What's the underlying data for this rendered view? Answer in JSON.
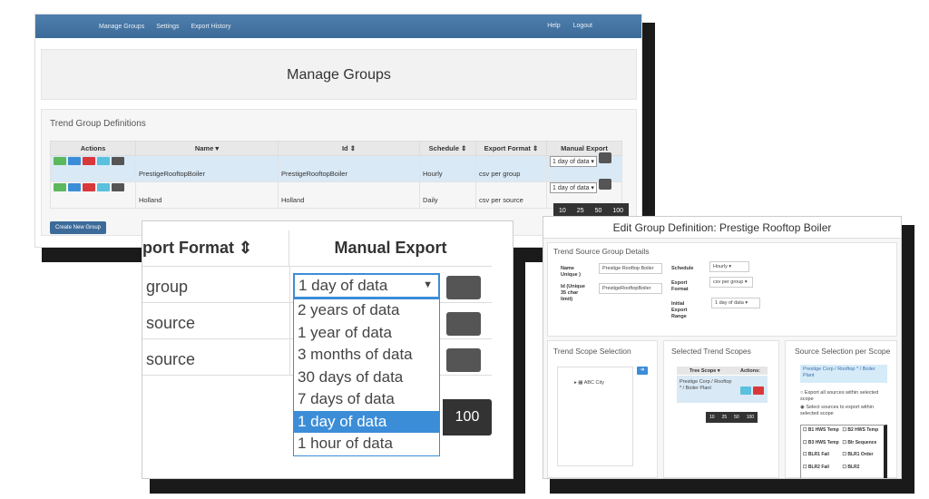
{
  "main": {
    "nav": {
      "items": [
        "Manage Groups",
        "Settings",
        "Export History"
      ],
      "right": [
        "Help",
        "Logout"
      ]
    },
    "page_title": "Manage Groups",
    "panel_title": "Trend Group Definitions",
    "columns": [
      "Actions",
      "Name",
      "Id",
      "Schedule",
      "Export Format",
      "Manual Export"
    ],
    "rows": [
      {
        "name": "PrestigeRooftopBoiler",
        "id": "PrestigeRooftopBoiler",
        "schedule": "Hourly",
        "format": "csv per group",
        "export": "1 day of data"
      },
      {
        "name": "Holland",
        "id": "Holland",
        "schedule": "Daily",
        "format": "csv per source",
        "export": "1 day of data"
      }
    ],
    "pager": [
      "10",
      "25",
      "50",
      "100"
    ],
    "create_label": "Create New Group"
  },
  "zoom": {
    "col_format": "port Format",
    "col_manual": "Manual Export",
    "rows": [
      "group",
      "source",
      "source"
    ],
    "selected": "1 day of data",
    "options": [
      "2 years of data",
      "1 year of data",
      "3 months of data",
      "30 days of data",
      "7 days of data",
      "1 day of data",
      "1 hour of data"
    ],
    "page_100": "100"
  },
  "edit": {
    "title": "Edit Group Definition: Prestige Rooftop Boiler",
    "details_title": "Trend Source Group Details",
    "name_label": "Name Unique )",
    "name_value": "Prestige Rooftop Boiler",
    "id_label": "Id (Unique 35 char limit)",
    "id_value": "PrestigeRooftopBoiler",
    "schedule_label": "Schedule",
    "schedule_value": "Hourly",
    "format_label": "Export Format",
    "format_value": "csv per group",
    "range_label": "Initial Export Range",
    "range_value": "1 day of data",
    "scope_title": "Trend Scope Selection",
    "tree_item": "ABC City",
    "selected_title": "Selected Trend Scopes",
    "tree_scope_col": "Tree Scope",
    "actions_col": "Actions:",
    "scope_value": "Prestige Corp / Rooftop * / Boiler Plant",
    "pager": [
      "10",
      "25",
      "50",
      "100"
    ],
    "source_title": "Source Selection per Scope",
    "scope_box": "Prestige Corp / Rooftop * / Boiler Plant",
    "radio1": "Export all sources within selected scope",
    "radio2": "Select sources to export within selected scope",
    "sources": [
      "B1 HWS Temp",
      "B2 HWS Temp",
      "B3 HWS Temp",
      "Blr Sequence",
      "BLR1 Fail",
      "BLR1 Order",
      "BLR2 Fail",
      "BLR2"
    ]
  }
}
